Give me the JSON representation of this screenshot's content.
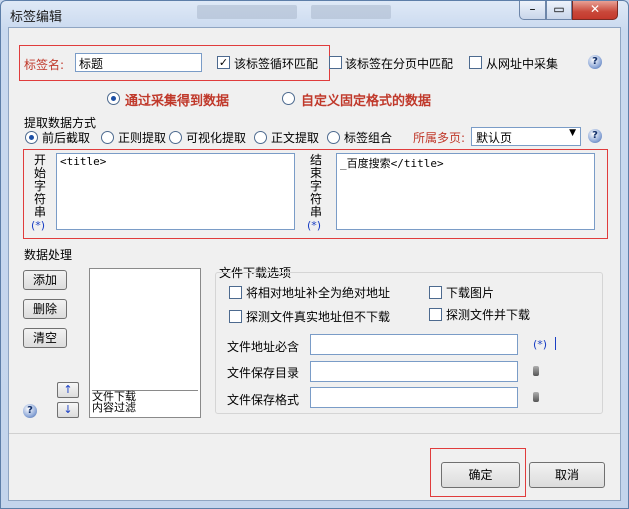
{
  "window": {
    "title": "标签编辑",
    "min_icon": "minimize-icon",
    "max_icon": "maximize-icon",
    "close_icon": "close-icon"
  },
  "tag": {
    "name_label": "标签名:",
    "name_value": "标题",
    "loop_match": {
      "label": "该标签循环匹配",
      "checked": true
    },
    "page_match": {
      "label": "该标签在分页中匹配",
      "checked": false
    },
    "from_url": {
      "label": "从网址中采集",
      "checked": false
    }
  },
  "source": {
    "collect_label": "通过采集得到数据",
    "collect_selected": true,
    "fixed_label": "自定义固定格式的数据",
    "fixed_selected": false
  },
  "extract": {
    "section_label": "提取数据方式",
    "methods": [
      {
        "label": "前后截取",
        "selected": true
      },
      {
        "label": "正则提取",
        "selected": false
      },
      {
        "label": "可视化提取",
        "selected": false
      },
      {
        "label": "正文提取",
        "selected": false
      },
      {
        "label": "标签组合",
        "selected": false
      }
    ],
    "multipage_label": "所属多页:",
    "multipage_value": "默认页",
    "start_label": "开始字符串",
    "start_link": "(*)",
    "start_value": "<title>",
    "end_label": "结束字符串",
    "end_link": "(*)",
    "end_value": "_百度搜索</title>"
  },
  "processing": {
    "section_label": "数据处理",
    "add_label": "添加",
    "delete_label": "删除",
    "clear_label": "清空",
    "items": [
      "文件下载",
      "内容过滤"
    ],
    "up_label": "↑",
    "down_label": "↓"
  },
  "download": {
    "section_label": "文件下载选项",
    "opt_absolute": {
      "label": "将相对地址补全为绝对地址",
      "checked": false
    },
    "opt_images": {
      "label": "下载图片",
      "checked": false
    },
    "opt_detect_only": {
      "label": "探测文件真实地址但不下载",
      "checked": false
    },
    "opt_detect_download": {
      "label": "探测文件并下载",
      "checked": false
    },
    "url_must_contain_label": "文件地址必含",
    "url_must_contain_value": "",
    "url_link": "(*)",
    "save_dir_label": "文件保存目录",
    "save_dir_value": "",
    "save_format_label": "文件保存格式",
    "save_format_value": ""
  },
  "buttons": {
    "ok_label": "确定",
    "cancel_label": "取消"
  },
  "help_glyph": "?"
}
